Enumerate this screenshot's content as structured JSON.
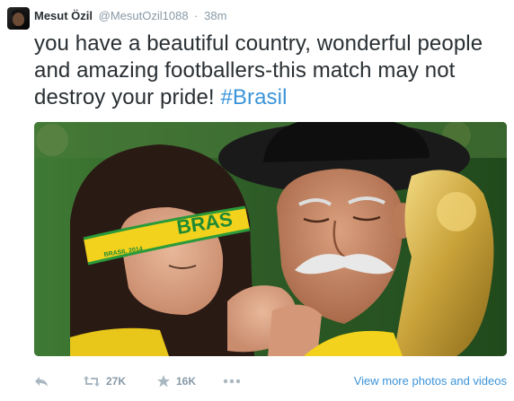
{
  "author": {
    "name": "Mesut Özil",
    "handle": "@MesutOzil1088",
    "separator": "·",
    "time": "38m"
  },
  "tweet": {
    "text_before_hashtag": "you have a beautiful country, wonderful people and amazing footballers-this match may not destroy your pride! ",
    "hashtag": "#Brasil"
  },
  "photo": {
    "headband_text": "BRAS",
    "headband_small_text": "BRASIL 2014"
  },
  "actions": {
    "retweet_count": "27K",
    "favorite_count": "16K",
    "view_more_label": "View more photos and videos"
  },
  "colors": {
    "accent": "#3b94d9",
    "muted": "#8899a6",
    "text": "#292f33"
  },
  "icons": {
    "reply": "reply-icon",
    "retweet": "retweet-icon",
    "favorite": "star-icon",
    "more": "more-icon"
  }
}
